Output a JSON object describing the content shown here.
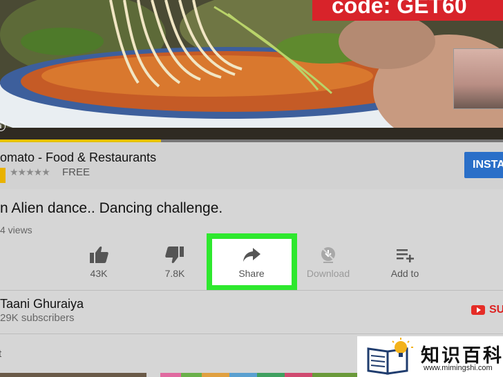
{
  "video": {
    "promo_text": "code: GET60",
    "progress": 0.32
  },
  "ad": {
    "title": "omato - Food & Restaurants",
    "stars": "★★★★★",
    "price": "FREE",
    "install_label": "INSTA"
  },
  "video_info": {
    "title": "n Alien dance.. Dancing challenge.",
    "views": "4 views"
  },
  "actions": [
    {
      "icon": "thumbs-up-icon",
      "label": "43K"
    },
    {
      "icon": "thumbs-down-icon",
      "label": "7.8K"
    },
    {
      "icon": "share-icon",
      "label": "Share"
    },
    {
      "icon": "download-icon",
      "label": "Download"
    },
    {
      "icon": "add-to-playlist-icon",
      "label": "Add to"
    }
  ],
  "channel": {
    "name": "Taani Ghuraiya",
    "subscribers": "29K subscribers",
    "subscribe_label": "SU"
  },
  "up_next": {
    "label": "t"
  },
  "watermark": {
    "title": "知识百科",
    "url": "www.mimingshi.com"
  },
  "colors": {
    "highlight": "#2ee82e",
    "install": "#2a6fc8",
    "subscribe": "#e52d27",
    "promo": "#d8232a",
    "progress": "#e7c200"
  }
}
